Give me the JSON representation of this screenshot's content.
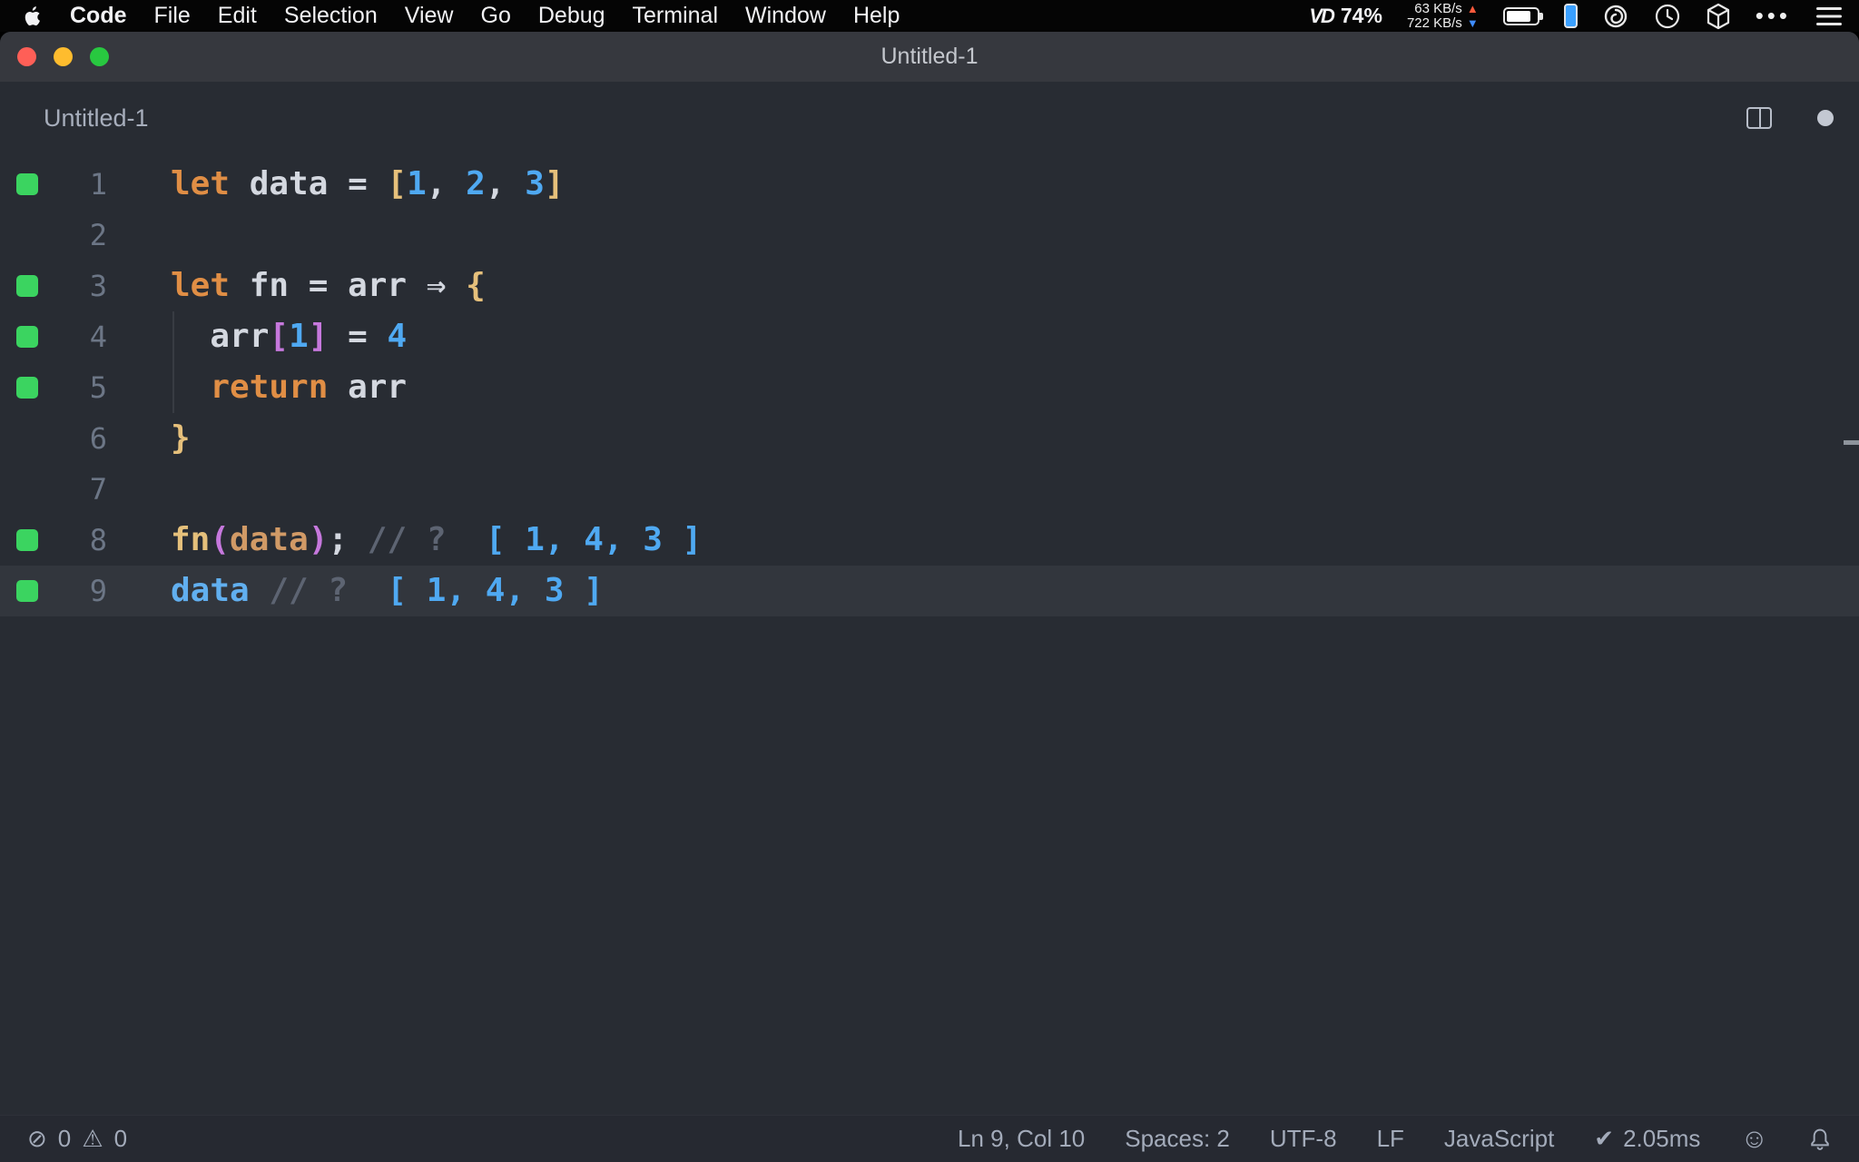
{
  "menu_bar": {
    "items": [
      "Code",
      "File",
      "Edit",
      "Selection",
      "View",
      "Go",
      "Debug",
      "Terminal",
      "Window",
      "Help"
    ],
    "vd_percent": "74%",
    "net_up": "63 KB/s",
    "net_down": "722 KB/s"
  },
  "window": {
    "title": "Untitled-1"
  },
  "tab_bar": {
    "filename": "Untitled-1"
  },
  "editor": {
    "active_line": 9,
    "lines": [
      {
        "num": 1,
        "covered": true,
        "tokens": [
          [
            "let",
            "kw"
          ],
          [
            " data = ",
            "pl"
          ],
          [
            "[",
            "b1"
          ],
          [
            "1",
            "num"
          ],
          [
            ", ",
            "pl"
          ],
          [
            "2",
            "num"
          ],
          [
            ", ",
            "pl"
          ],
          [
            "3",
            "num"
          ],
          [
            "]",
            "b1"
          ]
        ]
      },
      {
        "num": 2,
        "covered": false,
        "tokens": []
      },
      {
        "num": 3,
        "covered": true,
        "tokens": [
          [
            "let",
            "kw"
          ],
          [
            " fn = arr ",
            "pl"
          ],
          [
            "⇒",
            "arrow"
          ],
          [
            " ",
            "pl"
          ],
          [
            "{",
            "b1"
          ]
        ]
      },
      {
        "num": 4,
        "covered": true,
        "tokens": [
          [
            "  arr",
            "pl"
          ],
          [
            "[",
            "b2"
          ],
          [
            "1",
            "num"
          ],
          [
            "]",
            "b2"
          ],
          [
            " = ",
            "pl"
          ],
          [
            "4",
            "num"
          ]
        ]
      },
      {
        "num": 5,
        "covered": true,
        "tokens": [
          [
            "  ",
            "pl"
          ],
          [
            "return",
            "kw"
          ],
          [
            " arr",
            "pl"
          ]
        ]
      },
      {
        "num": 6,
        "covered": false,
        "tokens": [
          [
            "}",
            "b1"
          ]
        ]
      },
      {
        "num": 7,
        "covered": false,
        "tokens": []
      },
      {
        "num": 8,
        "covered": true,
        "tokens": [
          [
            "fn",
            "fn"
          ],
          [
            "(",
            "b2"
          ],
          [
            "data",
            "arg"
          ],
          [
            ")",
            "b2"
          ],
          [
            ";",
            "pl"
          ],
          [
            " // ? ",
            "cm"
          ],
          [
            " [ 1, 4, 3 ]",
            "out"
          ]
        ]
      },
      {
        "num": 9,
        "covered": true,
        "tokens": [
          [
            "data",
            "var"
          ],
          [
            " // ? ",
            "cm"
          ],
          [
            " [ 1, 4, 3 ]",
            "out"
          ]
        ]
      }
    ]
  },
  "status_bar": {
    "errors": "0",
    "warnings": "0",
    "cursor": "Ln 9, Col 10",
    "indent": "Spaces: 2",
    "encoding": "UTF-8",
    "eol": "LF",
    "language": "JavaScript",
    "quokka_time": "2.05ms"
  },
  "icons": {
    "vd": "VD",
    "ellipsis": "•••",
    "error": "⊘",
    "warning": "⚠︎",
    "check": "✔",
    "smiley": "☺",
    "arrow_up": "▲",
    "arrow_down": "▼"
  },
  "colors": {
    "editor_bg": "#282c33",
    "menu_bg": "#050505",
    "title_bar_bg": "#36383e",
    "coverage_green": "#3bd460",
    "keyword": "#e08e45",
    "number_blue": "#4fa9f2",
    "bracket_gold": "#e6c07b",
    "bracket_purple": "#c678dd",
    "comment_gray": "#5d6472",
    "traffic_red": "#ff5f57",
    "traffic_yellow": "#febc2e",
    "traffic_green": "#28c840"
  }
}
